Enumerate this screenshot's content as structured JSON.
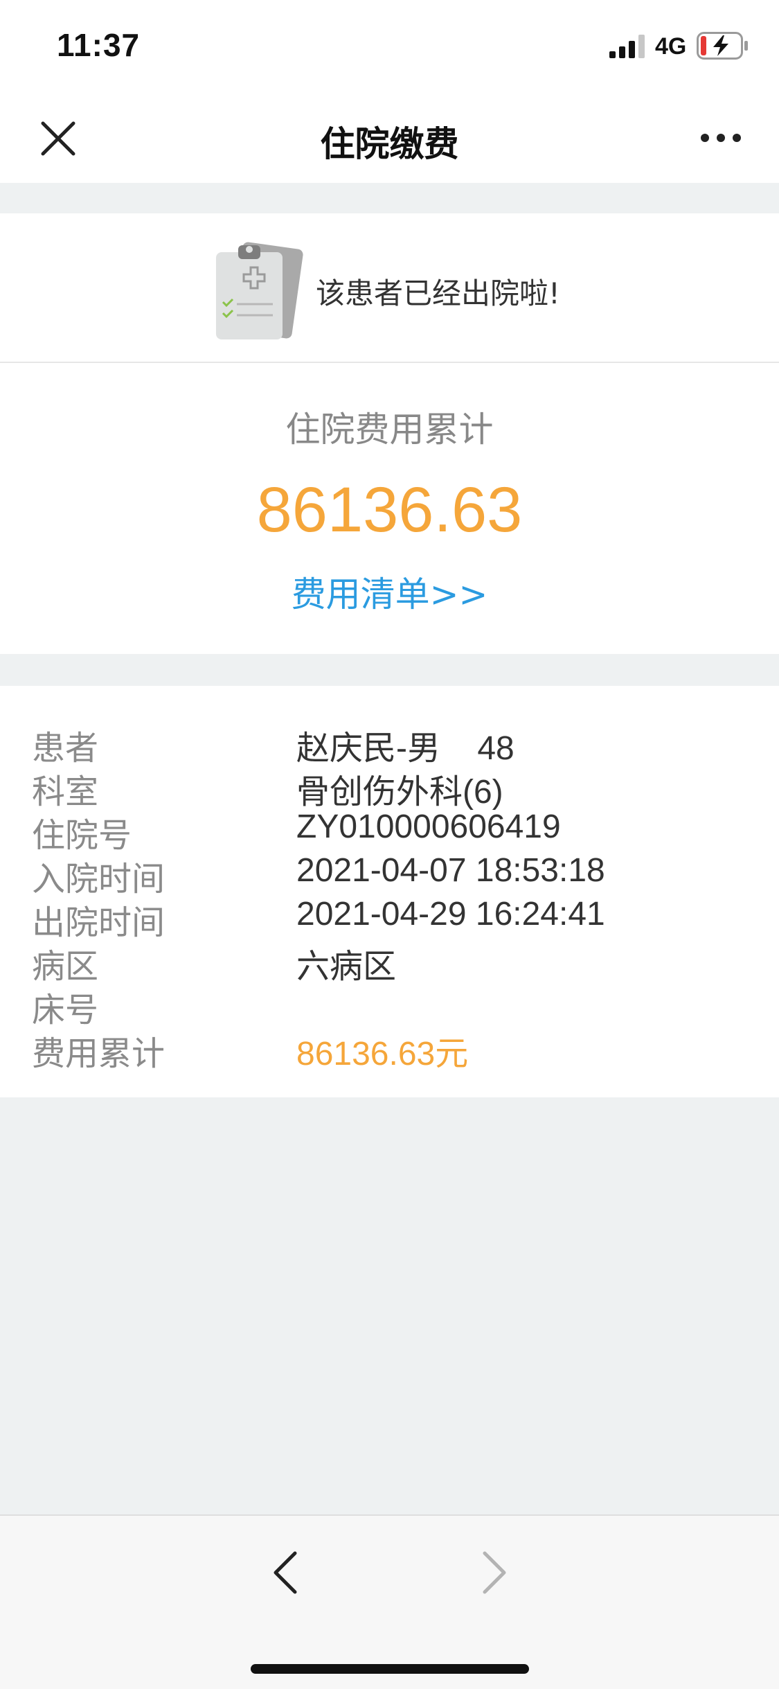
{
  "status_bar": {
    "time": "11:37",
    "network": "4G",
    "signal_icon": "cellular-signal-icon",
    "battery_icon": "battery-charging-low-icon"
  },
  "nav": {
    "title": "住院缴费",
    "close_icon": "close-icon",
    "more_icon": "more-dots-icon"
  },
  "notice": {
    "icon": "clipboard-medical-icon",
    "text": "该患者已经出院啦!"
  },
  "total": {
    "caption": "住院费用累计",
    "amount": "86136.63",
    "detail_link": "费用清单>>"
  },
  "patient_info": {
    "rows": [
      {
        "label": "患者",
        "value": "赵庆民-男    48"
      },
      {
        "label": "科室",
        "value": "骨创伤外科(6)"
      },
      {
        "label": "住院号",
        "value": "ZY010000606419"
      },
      {
        "label": "入院时间",
        "value": "2021-04-07 18:53:18"
      },
      {
        "label": "出院时间",
        "value": "2021-04-29 16:24:41"
      },
      {
        "label": "病区",
        "value": "六病区"
      },
      {
        "label": "床号",
        "value": ""
      },
      {
        "label": "费用累计",
        "value": "86136.63元"
      }
    ]
  },
  "toolbar": {
    "back_icon": "chevron-left-icon",
    "forward_icon": "chevron-right-icon"
  },
  "colors": {
    "accent_orange": "#f5a63a",
    "link_blue": "#2b9be0",
    "page_background": "#eef1f2",
    "label_gray": "#8a8a8a"
  }
}
